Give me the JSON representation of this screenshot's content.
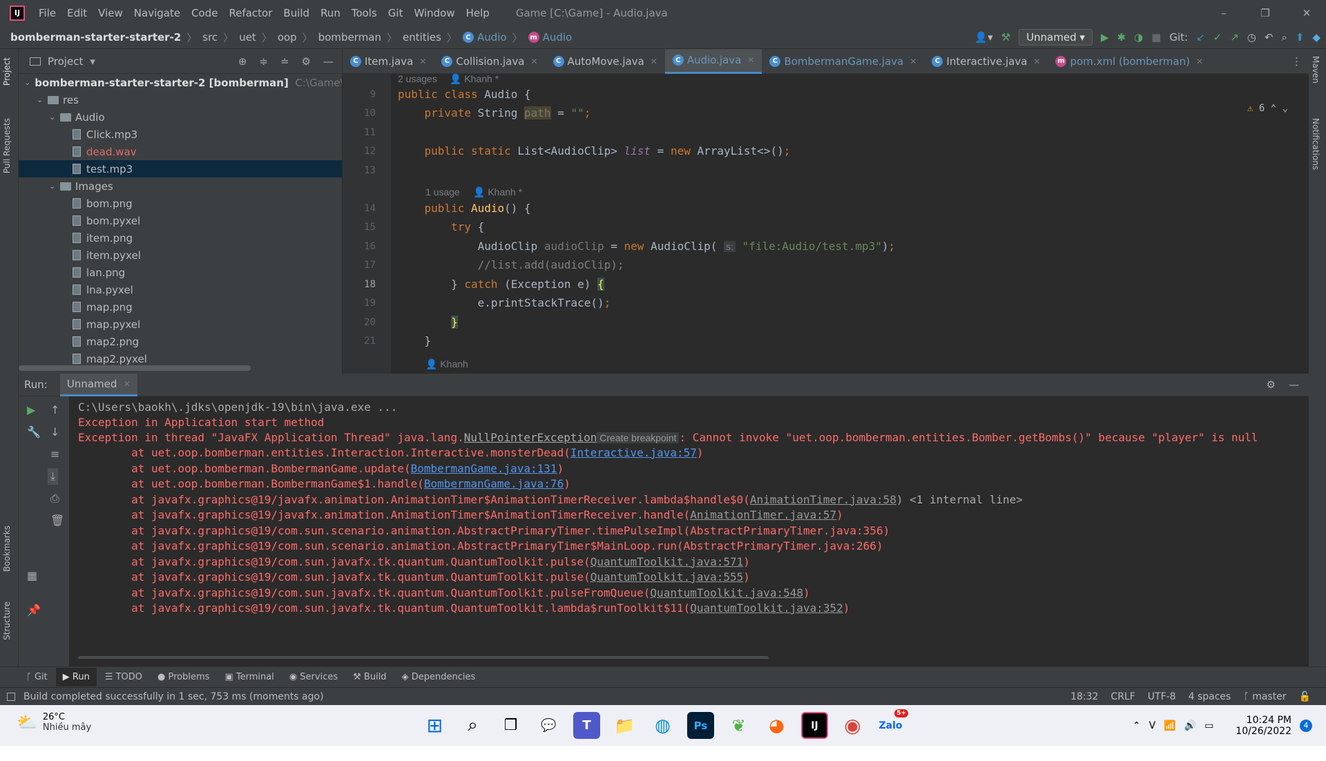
{
  "window": {
    "title": "Game [C:\\Game] - Audio.java",
    "logo": "IJ",
    "controls": [
      "–",
      "❐",
      "✕"
    ]
  },
  "menu": [
    "File",
    "Edit",
    "View",
    "Navigate",
    "Code",
    "Refactor",
    "Build",
    "Run",
    "Tools",
    "Git",
    "Window",
    "Help"
  ],
  "breadcrumbs": [
    "bomberman-starter-starter-2",
    "src",
    "uet",
    "oop",
    "bomberman",
    "entities",
    "Audio",
    "Audio"
  ],
  "toolbar": {
    "run_config": "Unnamed",
    "git_label": "Git:"
  },
  "project": {
    "header": "Project",
    "root": "bomberman-starter-starter-2 [bomberman]",
    "root_path": "C:\\Game\\bombe",
    "items": [
      {
        "label": "res",
        "type": "folder",
        "depth": 1
      },
      {
        "label": "Audio",
        "type": "folder",
        "depth": 2
      },
      {
        "label": "Click.mp3",
        "type": "file",
        "depth": 3
      },
      {
        "label": "dead.wav",
        "type": "file",
        "depth": 3,
        "color": "#e06c65"
      },
      {
        "label": "test.mp3",
        "type": "file",
        "depth": 3,
        "selected": true
      },
      {
        "label": "Images",
        "type": "folder",
        "depth": 2
      },
      {
        "label": "bom.png",
        "type": "file",
        "depth": 3
      },
      {
        "label": "bom.pyxel",
        "type": "file",
        "depth": 3
      },
      {
        "label": "item.png",
        "type": "file",
        "depth": 3
      },
      {
        "label": "item.pyxel",
        "type": "file",
        "depth": 3
      },
      {
        "label": "lan.png",
        "type": "file",
        "depth": 3
      },
      {
        "label": "lna.pyxel",
        "type": "file",
        "depth": 3
      },
      {
        "label": "map.png",
        "type": "file",
        "depth": 3
      },
      {
        "label": "map.pyxel",
        "type": "file",
        "depth": 3
      },
      {
        "label": "map2.png",
        "type": "file",
        "depth": 3
      },
      {
        "label": "map2.pyxel",
        "type": "file",
        "depth": 3
      }
    ]
  },
  "tabs": [
    {
      "label": "Item.java",
      "icon": "C"
    },
    {
      "label": "Collision.java",
      "icon": "C"
    },
    {
      "label": "AutoMove.java",
      "icon": "C"
    },
    {
      "label": "Audio.java",
      "icon": "C",
      "active": true
    },
    {
      "label": "BombermanGame.java",
      "icon": "C",
      "blue": true
    },
    {
      "label": "Interactive.java",
      "icon": "C"
    },
    {
      "label": "pom.xml (bomberman)",
      "icon": "m",
      "blue": true
    }
  ],
  "editor": {
    "warnings": "6",
    "hints": {
      "usages2": "2 usages",
      "author1": "Khanh *",
      "usage1": "1 usage",
      "author2": "Khanh *",
      "author3": "Khanh"
    },
    "line_numbers": [
      "9",
      "10",
      "11",
      "12",
      "13",
      "14",
      "15",
      "16",
      "17",
      "18",
      "19",
      "20",
      "21"
    ]
  },
  "run": {
    "label": "Run:",
    "tab": "Unnamed",
    "cmd": "C:\\Users\\baokh\\.jdks\\openjdk-19\\bin\\java.exe ...",
    "l1": "Exception in Application start method",
    "l2a": "Exception in thread \"JavaFX Application Thread\" java.lang.",
    "l2b": "NullPointerException",
    "l2c": " Create breakpoint ",
    "l2d": ": Cannot invoke \"uet.oop.bomberman.entities.Bomber.getBombs()\" because \"player\" is null",
    "stack": [
      {
        "pre": "\tat uet.oop.bomberman.entities.Interaction.Interactive.monsterDead(",
        "link": "Interactive.java:57",
        "post": ")",
        "linkcls": "lnk"
      },
      {
        "pre": "\tat uet.oop.bomberman.BombermanGame.update(",
        "link": "BombermanGame.java:131",
        "post": ")",
        "linkcls": "lnk"
      },
      {
        "pre": "\tat uet.oop.bomberman.BombermanGame$1.handle(",
        "link": "BombermanGame.java:76",
        "post": ")",
        "linkcls": "lnk"
      },
      {
        "pre": "\tat javafx.graphics@19/javafx.animation.AnimationTimer$AnimationTimerReceiver.lambda$handle$0(",
        "link": "AnimationTimer.java:58",
        "post": ") <1 internal line>",
        "linkcls": "dim"
      },
      {
        "pre": "\tat javafx.graphics@19/javafx.animation.AnimationTimer$AnimationTimerReceiver.handle(",
        "link": "AnimationTimer.java:57",
        "post": ")",
        "linkcls": "dim"
      },
      {
        "pre": "\tat javafx.graphics@19/com.sun.scenario.animation.AbstractPrimaryTimer.timePulseImpl(AbstractPrimaryTimer.java:356)",
        "link": "",
        "post": "",
        "linkcls": "dim"
      },
      {
        "pre": "\tat javafx.graphics@19/com.sun.scenario.animation.AbstractPrimaryTimer$MainLoop.run(AbstractPrimaryTimer.java:266)",
        "link": "",
        "post": "",
        "linkcls": "dim"
      },
      {
        "pre": "\tat javafx.graphics@19/com.sun.javafx.tk.quantum.QuantumToolkit.pulse(",
        "link": "QuantumToolkit.java:571",
        "post": ")",
        "linkcls": "dim"
      },
      {
        "pre": "\tat javafx.graphics@19/com.sun.javafx.tk.quantum.QuantumToolkit.pulse(",
        "link": "QuantumToolkit.java:555",
        "post": ")",
        "linkcls": "dim"
      },
      {
        "pre": "\tat javafx.graphics@19/com.sun.javafx.tk.quantum.QuantumToolkit.pulseFromQueue(",
        "link": "QuantumToolkit.java:548",
        "post": ")",
        "linkcls": "dim"
      },
      {
        "pre": "\tat javafx.graphics@19/com.sun.javafx.tk.quantum.QuantumToolkit.lambda$runToolkit$11(",
        "link": "QuantumToolkit.java:352",
        "post": ")",
        "linkcls": "dim"
      }
    ]
  },
  "bottom_tabs": [
    "Git",
    "Run",
    "TODO",
    "Problems",
    "Terminal",
    "Services",
    "Build",
    "Dependencies"
  ],
  "status": {
    "message": "Build completed successfully in 1 sec, 753 ms (moments ago)",
    "position": "18:32",
    "line_sep": "CRLF",
    "encoding": "UTF-8",
    "indent": "4 spaces",
    "branch": "master"
  },
  "side": {
    "project": "Project",
    "pull": "Pull Requests",
    "bookmarks": "Bookmarks",
    "structure": "Structure",
    "maven": "Maven",
    "notifications": "Notifications"
  },
  "taskbar": {
    "temp": "26°C",
    "weather": "Nhiều mây",
    "time": "10:24 PM",
    "date": "10/26/2022",
    "badge": "4",
    "zalo_badge": "5+"
  }
}
